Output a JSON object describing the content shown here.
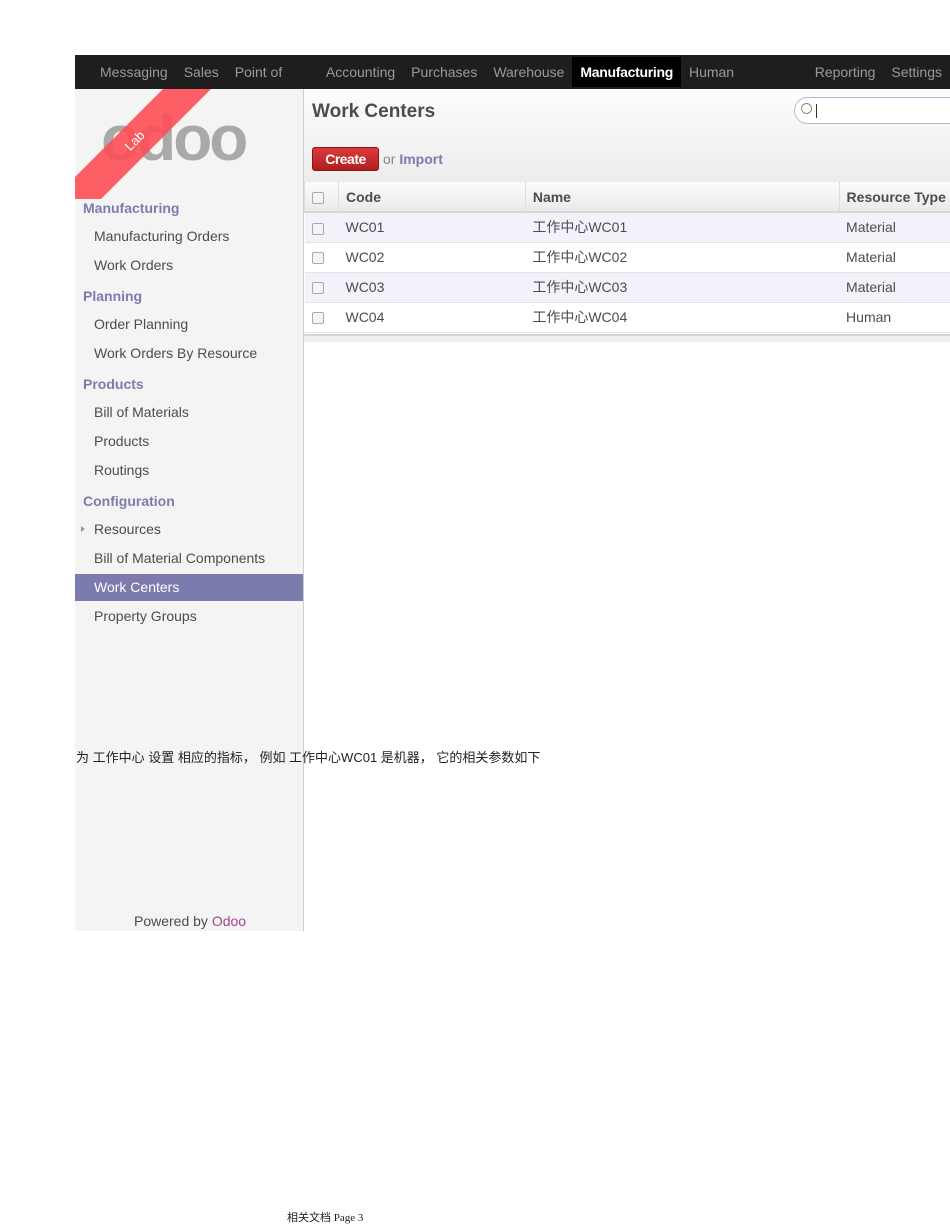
{
  "navbar": {
    "items": [
      "Messaging",
      "Sales",
      "Point of Sale",
      "Accounting",
      "Purchases",
      "Warehouse",
      "Manufacturing",
      "Human Resources",
      "Reporting",
      "Settings"
    ],
    "active": "Manufacturing"
  },
  "logo": {
    "text": "odoo",
    "ribbon": "Lab"
  },
  "sidebar": {
    "sections": [
      {
        "title": "Manufacturing",
        "items": [
          "Manufacturing Orders",
          "Work Orders"
        ]
      },
      {
        "title": "Planning",
        "items": [
          "Order Planning",
          "Work Orders By Resource"
        ]
      },
      {
        "title": "Products",
        "items": [
          "Bill of Materials",
          "Products",
          "Routings"
        ]
      },
      {
        "title": "Configuration",
        "items": [
          "Resources",
          "Bill of Material Components",
          "Work Centers",
          "Property Groups"
        ]
      }
    ],
    "active": "Work Centers",
    "powered_prefix": "Powered by",
    "powered_brand": "Odoo"
  },
  "main": {
    "title": "Work Centers",
    "create_label": "Create",
    "or_text": "or",
    "import_label": "Import",
    "search_value": ""
  },
  "table": {
    "columns": [
      "Code",
      "Name",
      "Resource Type"
    ],
    "rows": [
      [
        "WC01",
        "工作中心WC01",
        "Material"
      ],
      [
        "WC02",
        "工作中心WC02",
        "Material"
      ],
      [
        "WC03",
        "工作中心WC03",
        "Material"
      ],
      [
        "WC04",
        "工作中心WC04",
        "Human"
      ]
    ]
  },
  "document": {
    "caption": "为 工作中心 设置 相应的指标， 例如 工作中心WC01 是机器， 它的相关参数如下",
    "footer": "相关文档 Page 3"
  },
  "colors": {
    "accent": "#7c7bad",
    "create": "#c62828",
    "navbar": "#1e1e1e"
  }
}
